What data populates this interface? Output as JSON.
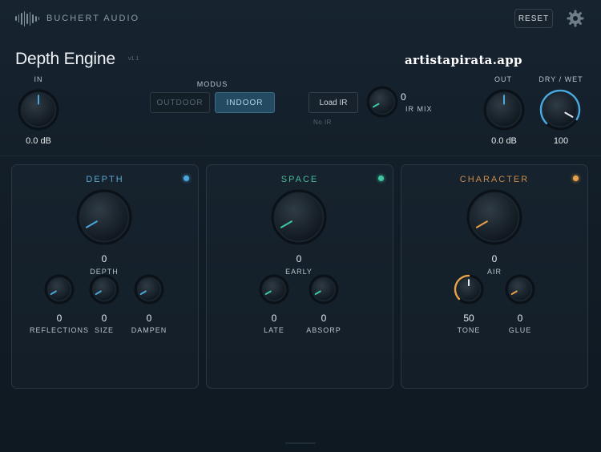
{
  "brand": "BUCHERT AUDIO",
  "reset_label": "RESET",
  "title": "Depth Engine",
  "version": "v1.1",
  "watermark": "artistapirata.app",
  "colors": {
    "depth": "#4aa8dc",
    "space": "#3ec9a0",
    "character": "#e8a24a",
    "mode_active": "#234a60"
  },
  "input": {
    "label": "IN",
    "value": "0.0 dB"
  },
  "modus": {
    "label": "MODUS",
    "options": [
      "OUTDOOR",
      "INDOOR"
    ],
    "selected": "INDOOR"
  },
  "ir": {
    "load_label": "Load IR",
    "status": "No IR",
    "mix_value": "0",
    "mix_label": "IR MIX"
  },
  "output": {
    "label": "OUT",
    "value": "0.0 dB"
  },
  "drywet": {
    "label": "DRY / WET",
    "value": "100"
  },
  "panels": {
    "depth": {
      "title": "DEPTH",
      "main": {
        "value": "0",
        "label": "DEPTH"
      },
      "knobs": [
        {
          "value": "0",
          "label": "REFLECTIONS"
        },
        {
          "value": "0",
          "label": "SIZE"
        },
        {
          "value": "0",
          "label": "DAMPEN"
        }
      ]
    },
    "space": {
      "title": "SPACE",
      "main": {
        "value": "0",
        "label": "EARLY"
      },
      "knobs": [
        {
          "value": "0",
          "label": "LATE"
        },
        {
          "value": "0",
          "label": "ABSORP"
        }
      ]
    },
    "character": {
      "title": "CHARACTER",
      "main": {
        "value": "0",
        "label": "AIR"
      },
      "knobs": [
        {
          "value": "50",
          "label": "TONE"
        },
        {
          "value": "0",
          "label": "GLUE"
        }
      ]
    }
  },
  "icons": {
    "logo": "waveform-icon",
    "settings": "gear-icon"
  }
}
